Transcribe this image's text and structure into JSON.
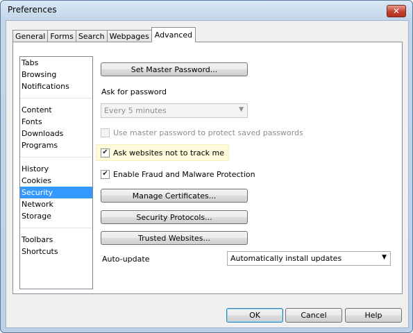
{
  "window": {
    "title": "Preferences",
    "close": "✕"
  },
  "tabs": [
    {
      "label": "General"
    },
    {
      "label": "Forms"
    },
    {
      "label": "Search"
    },
    {
      "label": "Webpages"
    },
    {
      "label": "Advanced",
      "active": true
    }
  ],
  "sidebar": {
    "groups": [
      [
        "Tabs",
        "Browsing",
        "Notifications"
      ],
      [
        "Content",
        "Fonts",
        "Downloads",
        "Programs"
      ],
      [
        "History",
        "Cookies",
        "Security",
        "Network",
        "Storage"
      ],
      [
        "Toolbars",
        "Shortcuts"
      ]
    ],
    "selected": "Security"
  },
  "security": {
    "set_master_password": "Set Master Password...",
    "ask_for_password_label": "Ask for password",
    "ask_for_password_value": "Every 5 minutes",
    "use_master_password": "Use master password to protect saved passwords",
    "do_not_track": "Ask websites not to track me",
    "fraud_protection": "Enable Fraud and Malware Protection",
    "manage_certificates": "Manage Certificates...",
    "security_protocols": "Security Protocols...",
    "trusted_websites": "Trusted Websites...",
    "auto_update_label": "Auto-update",
    "auto_update_value": "Automatically install updates",
    "do_not_track_checked": true,
    "fraud_protection_checked": true,
    "use_master_password_checked": false
  },
  "footer": {
    "ok": "OK",
    "cancel": "Cancel",
    "help": "Help"
  }
}
